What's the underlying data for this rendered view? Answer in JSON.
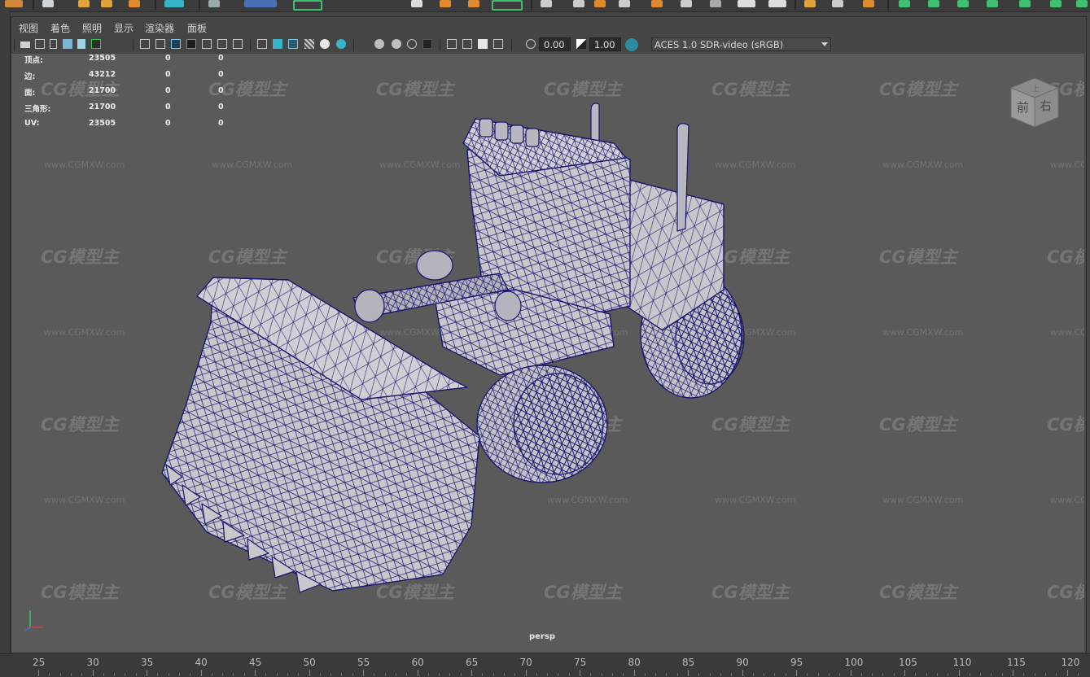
{
  "menu": [
    "视图",
    "着色",
    "照明",
    "显示",
    "渲染器",
    "面板"
  ],
  "toolbar": {
    "exposure_value": "0.00",
    "gamma_value": "1.00",
    "color_space": "ACES 1.0 SDR-video (sRGB)",
    "icons": [
      "camera-select-icon",
      "camera-attributes-icon",
      "bookmarks-icon",
      "image-plane-icon",
      "grid-icon",
      "film-gate-icon",
      "resolution-gate-icon",
      "gate-mask-icon",
      "field-chart-icon",
      "safe-action-icon",
      "safe-title-icon",
      "wireframe-icon",
      "smooth-shade-icon",
      "wireframe-on-shaded-icon",
      "textured-icon",
      "use-all-lights-icon",
      "shadows-icon",
      "screen-space-ao-icon",
      "motion-blur-icon",
      "anti-aliasing-icon",
      "depth-of-field-icon",
      "isolate-select-icon",
      "xray-icon",
      "xray-active-components-icon",
      "xray-joints-icon",
      "exposure-icon",
      "gamma-icon",
      "color-management-icon"
    ]
  },
  "heads_up": {
    "rows": [
      {
        "label": "顶点:",
        "value": "23505",
        "a": "0",
        "b": "0"
      },
      {
        "label": "边:",
        "value": "43212",
        "a": "0",
        "b": "0"
      },
      {
        "label": "面:",
        "value": "21700",
        "a": "0",
        "b": "0"
      },
      {
        "label": "三角形:",
        "value": "21700",
        "a": "0",
        "b": "0"
      },
      {
        "label": "UV:",
        "value": "23505",
        "a": "0",
        "b": "0"
      }
    ]
  },
  "viewport": {
    "camera_label": "persp",
    "view_cube": {
      "front": "前",
      "right": "右",
      "top": "上"
    },
    "watermark_logo": "CG模型主",
    "watermark_url": "www.CGMXW.com",
    "model": "bulldozer-wireframe-on-shaded"
  },
  "timeline": {
    "ticks": [
      "25",
      "30",
      "35",
      "40",
      "45",
      "50",
      "55",
      "60",
      "65",
      "70",
      "75",
      "80",
      "85",
      "90",
      "95",
      "100",
      "105",
      "110",
      "115",
      "120"
    ]
  },
  "colors": {
    "viewport_bg": "#5a5a5a",
    "wire": "#16146e",
    "shaded": "#c8c8cc",
    "active_tool": "#37b4c8",
    "shelf_green": "#3fbf6f",
    "shelf_orange": "#e08a2e"
  }
}
